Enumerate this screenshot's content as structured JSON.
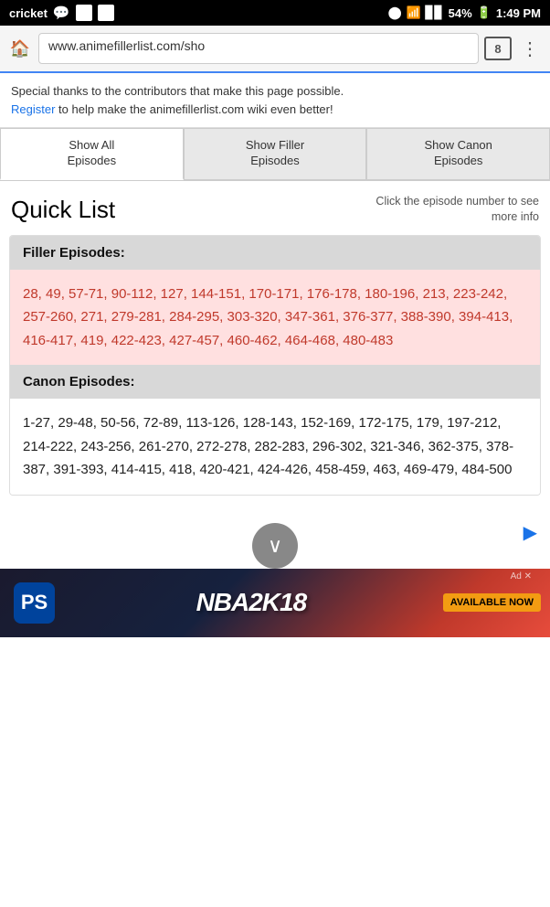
{
  "status_bar": {
    "carrier": "cricket",
    "bluetooth": "⬤",
    "wifi": "WiFi",
    "signal": "▋▋▋",
    "battery": "54%",
    "time": "1:49 PM"
  },
  "browser": {
    "url": "www.animefillerlist.com/sho",
    "tab_count": "8"
  },
  "info_text": "Special thanks to the contributors that make this page possible.",
  "info_link": "Register",
  "info_text2": " to help make the animefillerlist.com wiki even better!",
  "tabs": [
    {
      "label": "Show All\nEpisodes",
      "active": true
    },
    {
      "label": "Show Filler\nEpisodes",
      "active": false
    },
    {
      "label": "Show Canon\nEpisodes",
      "active": false
    }
  ],
  "quick_list": {
    "title": "Quick List",
    "hint": "Click the episode number to see more info"
  },
  "filler": {
    "header": "Filler Episodes:",
    "episodes": "28, 49, 57-71, 90-112, 127, 144-151, 170-171, 176-178, 180-196, 213, 223-242, 257-260, 271, 279-281, 284-295, 303-320, 347-361, 376-377, 388-390, 394-413, 416-417, 419, 422-423, 427-457, 460-462, 464-468, 480-483"
  },
  "canon": {
    "header": "Canon Episodes:",
    "episodes": "1-27, 29-48, 50-56, 72-89, 113-126, 128-143, 152-169, 172-175, 179, 197-212, 214-222, 243-256, 261-270, 272-278, 282-283, 296-302, 321-346, 362-375, 378-387, 391-393, 414-415, 418, 420-421, 424-426, 458-459, 463, 469-479, 484-500"
  },
  "ad": {
    "ps_label": "PS",
    "nba_text": "NBA2K18",
    "available": "AVAILABLE NOW",
    "close_x": "✕",
    "ad_label": "Ad ✕"
  },
  "scroll_btn": "∨"
}
